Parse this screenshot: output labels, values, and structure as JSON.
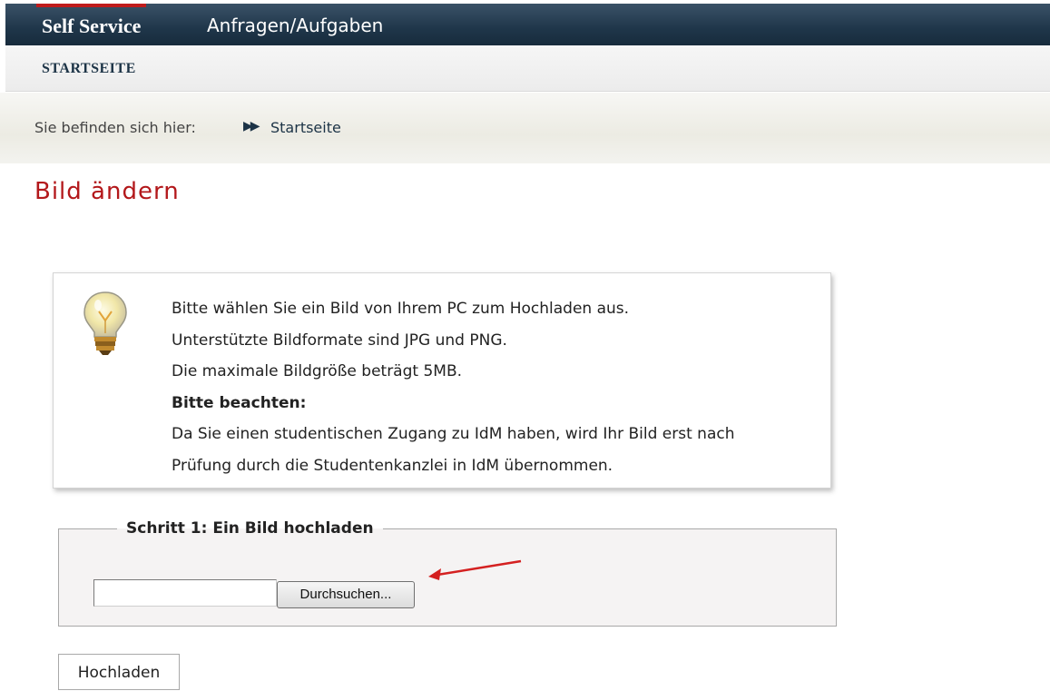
{
  "header": {
    "tabs": [
      {
        "label": "Self Service",
        "active": true
      },
      {
        "label": "Anfragen/Aufgaben",
        "active": false
      }
    ],
    "subnav_label": "STARTSEITE"
  },
  "breadcrumb": {
    "prefix": "Sie befinden sich hier:",
    "items": [
      "Startseite"
    ]
  },
  "page": {
    "title": "Bild ändern"
  },
  "info": {
    "icon": "lightbulb-icon",
    "lines": [
      "Bitte wählen Sie ein Bild von Ihrem PC zum Hochladen aus.",
      "Unterstützte Bildformate sind JPG und PNG.",
      "Die maximale Bildgröße beträgt 5MB."
    ],
    "notice_heading": "Bitte beachten:",
    "notice_lines": [
      "Da Sie einen studentischen Zugang zu IdM haben, wird Ihr Bild erst nach",
      "Prüfung durch die Studentenkanzlei in IdM übernommen."
    ]
  },
  "step1": {
    "legend": "Schritt 1: Ein Bild hochladen",
    "file_value": "",
    "browse_label": "Durchsuchen..."
  },
  "upload_label": "Hochladen",
  "colors": {
    "header_bg": "#1f364a",
    "active_tab_accent": "#c01b1b",
    "title": "#b3181b",
    "annotation_arrow": "#d42020"
  }
}
